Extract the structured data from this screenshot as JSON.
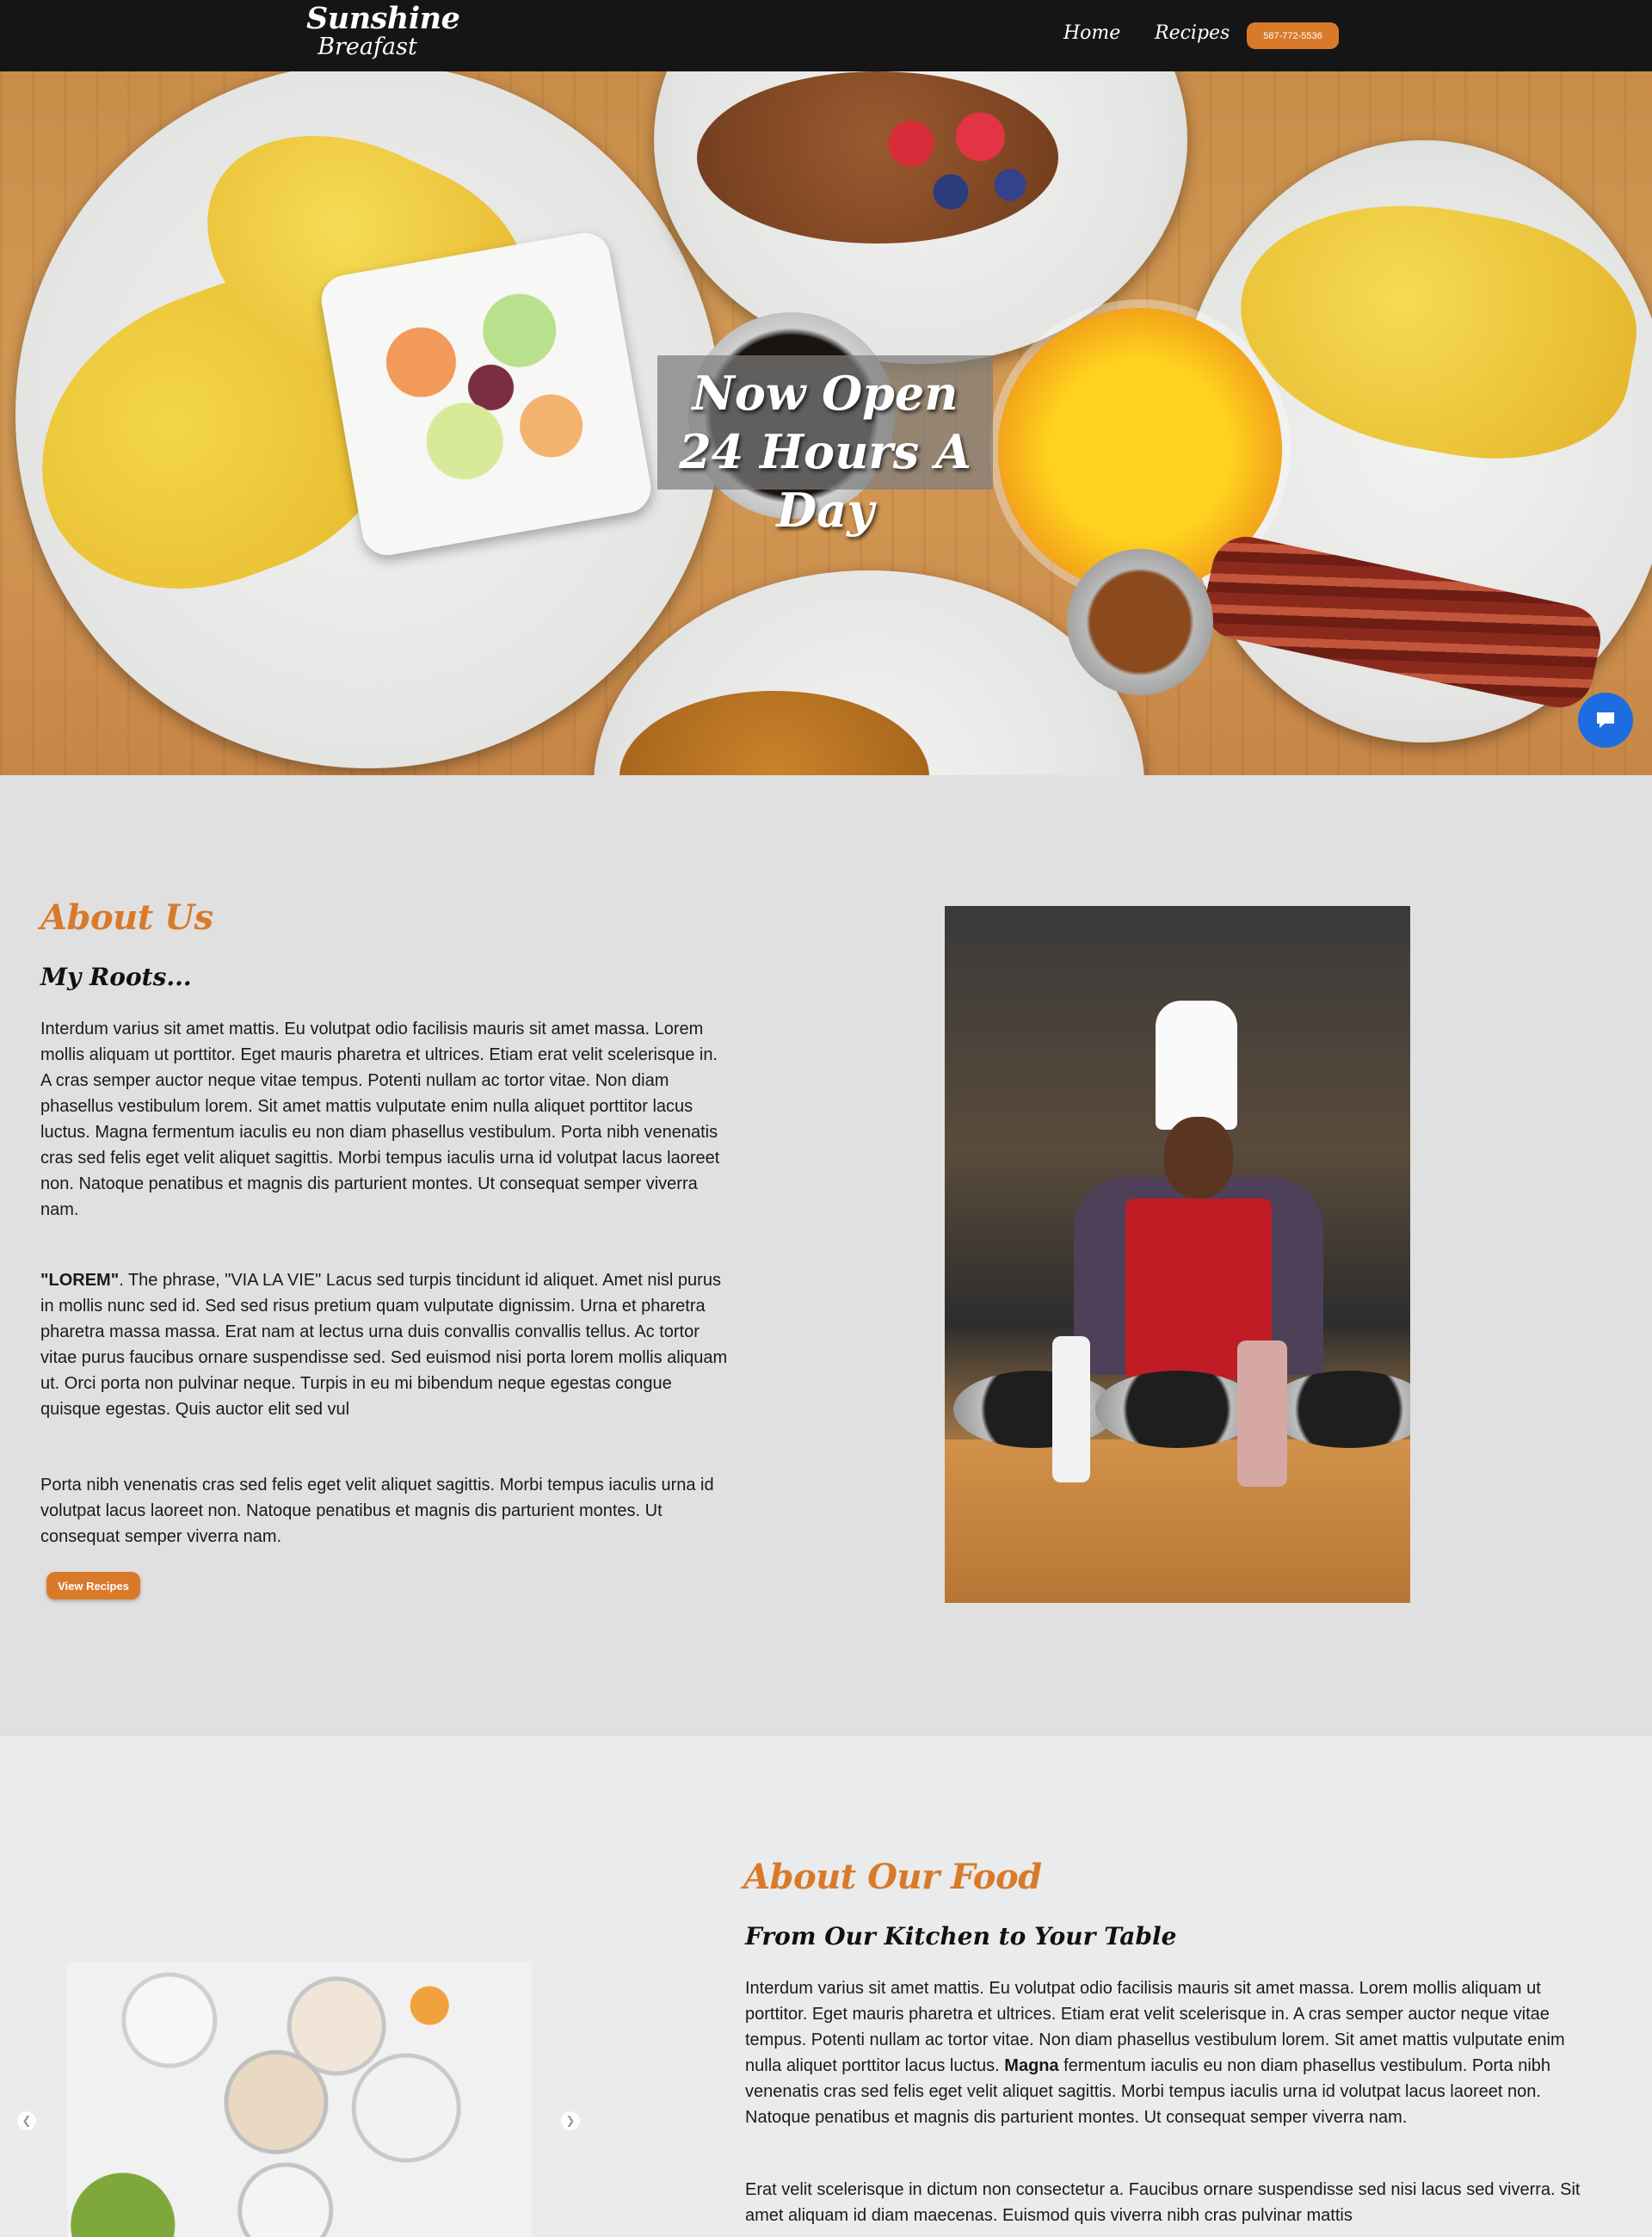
{
  "header": {
    "brand_name": "Sunshine",
    "brand_sub": "Breafast",
    "nav": [
      {
        "label": "Home"
      },
      {
        "label": "Recipes"
      }
    ],
    "phone": "587-772-5536",
    "accent_color": "#d97a2a",
    "bar_color": "#151515"
  },
  "hero": {
    "caption_line1": "Now Open",
    "caption_line2": "24 Hours A Day",
    "slides_total": 2,
    "active_slide": 2,
    "chat_icon": "chat-bubble-icon"
  },
  "about": {
    "title": "About Us",
    "subtitle": "My Roots...",
    "p1": "Interdum varius sit amet mattis. Eu volutpat odio facilisis mauris sit amet massa. Lorem mollis aliquam ut porttitor. Eget mauris pharetra et ultrices. Etiam erat velit scelerisque in. A cras semper auctor neque vitae tempus. Potenti nullam ac tortor vitae. Non diam phasellus vestibulum lorem. Sit amet mattis vulputate enim nulla aliquet porttitor lacus luctus. Magna fermentum iaculis eu non diam phasellus vestibulum. Porta nibh venenatis cras sed felis eget velit aliquet sagittis. Morbi tempus iaculis urna id volutpat lacus laoreet non. Natoque penatibus et magnis dis parturient montes. Ut consequat semper viverra nam.",
    "p2_bold": "\"LOREM\"",
    "p2_rest": ". The phrase, \"VIA LA VIE\" Lacus sed turpis tincidunt id aliquet. Amet nisl purus in mollis nunc sed id. Sed sed risus pretium quam vulputate dignissim. Urna et pharetra pharetra massa massa. Erat nam at lectus urna duis convallis convallis tellus. Ac tortor vitae purus faucibus ornare suspendisse sed. Sed euismod nisi porta lorem mollis aliquam ut. Orci porta non pulvinar neque. Turpis in eu mi bibendum neque egestas congue quisque egestas. Quis auctor elit sed vul",
    "p3": "Porta nibh venenatis cras sed felis eget velit aliquet sagittis. Morbi tempus iaculis urna id volutpat lacus laoreet non. Natoque penatibus et magnis dis parturient montes. Ut consequat semper viverra nam.",
    "button_label": "View Recipes"
  },
  "food": {
    "title": "About Our Food",
    "subtitle": "From Our Kitchen to Your Table",
    "p1_before": "Interdum varius sit amet mattis. Eu volutpat odio facilisis mauris sit amet massa. Lorem mollis aliquam ut porttitor. Eget mauris pharetra et ultrices. Etiam erat velit scelerisque in. A cras semper auctor neque vitae tempus. Potenti nullam ac tortor vitae. Non diam phasellus vestibulum lorem. Sit amet mattis vulputate enim nulla aliquet porttitor lacus luctus. ",
    "p1_bold": "Magna",
    "p1_after": " fermentum iaculis eu non diam phasellus vestibulum. Porta nibh venenatis cras sed felis eget velit aliquet sagittis. Morbi tempus iaculis urna id volutpat lacus laoreet non. Natoque penatibus et magnis dis parturient montes. Ut consequat semper viverra nam.",
    "p2": "Erat velit scelerisque in dictum non consectetur a. Faucibus ornare suspendisse sed nisi lacus sed viverra. Sit amet aliquam id diam maecenas. Euismod quis viverra nibh cras pulvinar mattis",
    "arrow_left_icon": "chevron-left-icon",
    "arrow_right_icon": "chevron-right-icon"
  }
}
